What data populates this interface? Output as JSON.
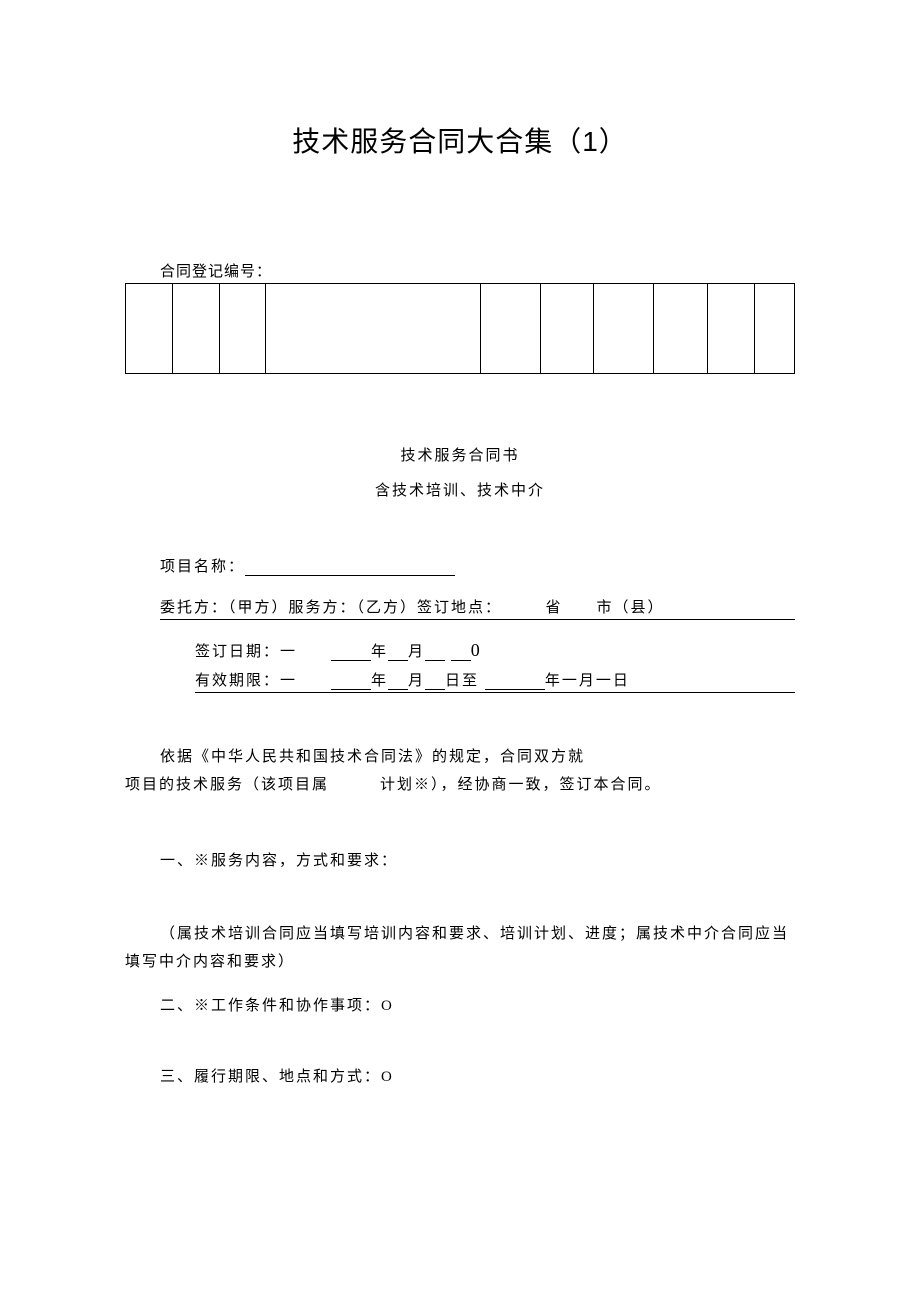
{
  "title": "技术服务合同大合集（1）",
  "registration_label": "合同登记编号：",
  "subtitle1": "技术服务合同书",
  "subtitle2": "含技术培训、技术中介",
  "project": {
    "label": "项目名称："
  },
  "party_line": "委托方：（甲方）服务方：（乙方）签订地点：　　　省　　市（县）",
  "date_sign": {
    "prefix": "签订日期：一　　",
    "year": "年",
    "month": "月",
    "end": "0"
  },
  "date_valid": {
    "prefix": "有效期限：一　　",
    "year": "年",
    "month": "月",
    "day_to": "日至",
    "suffix": "年一月一日"
  },
  "para1_line1": "依据《中华人民共和国技术合同法》的规定，合同双方就",
  "para1_line2": "项目的技术服务（该项目属　　　计划※），经协商一致，签订本合同。",
  "section1": "一、※服务内容，方式和要求：",
  "note1": "（属技术培训合同应当填写培训内容和要求、培训计划、进度；属技术中介合同应当填写中介内容和要求）",
  "section2": "二、※工作条件和协作事项：O",
  "section3": "三、履行期限、地点和方式：O"
}
